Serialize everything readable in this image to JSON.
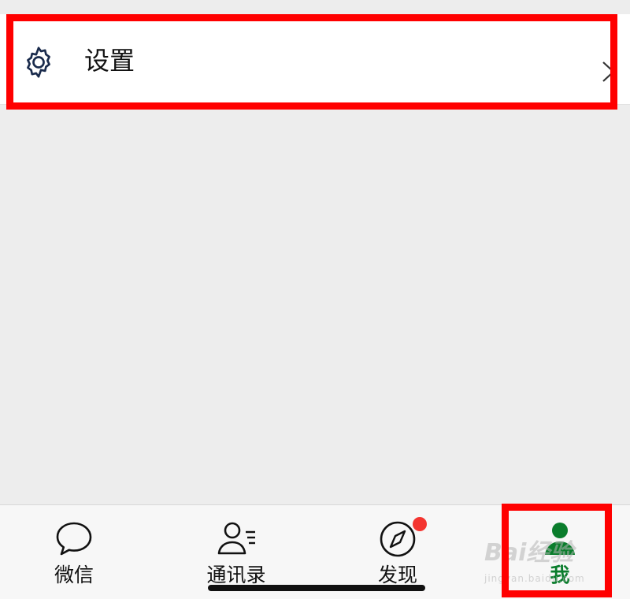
{
  "settings_row": {
    "icon": "gear-icon",
    "label": "设置",
    "chevron_icon": "chevron-right-icon"
  },
  "tabbar": {
    "tabs": [
      {
        "label": "微信",
        "icon": "chat-bubble-icon",
        "active": false
      },
      {
        "label": "通讯录",
        "icon": "contacts-icon",
        "active": false
      },
      {
        "label": "发现",
        "icon": "compass-icon",
        "active": false,
        "badge": true
      },
      {
        "label": "我",
        "icon": "person-icon",
        "active": true
      }
    ]
  },
  "watermark": {
    "brand": "Bai经验",
    "url": "jingyan.baidu.com"
  },
  "colors": {
    "annotation": "#ff0000",
    "active_tab": "#0a7d2c",
    "badge": "#f43530",
    "background": "#ededed"
  }
}
